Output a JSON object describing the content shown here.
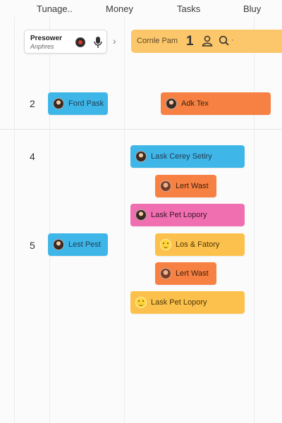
{
  "header": {
    "columns": [
      "Tunage..",
      "Money",
      "Tasks",
      "Bluy"
    ]
  },
  "search_card": {
    "title": "Presower",
    "subtitle": "Anphres"
  },
  "top_banner": {
    "label": "Cornle Pam",
    "count": "1"
  },
  "rows": {
    "row_2": "2",
    "row_4": "4",
    "row_5": "5"
  },
  "tasks": [
    {
      "label": "Ford Pask",
      "color": "#3fb6e8",
      "text_color": "#1d3a4f",
      "avatar": "avatar-dark"
    },
    {
      "label": "Adk Tex",
      "color": "#f78143",
      "text_color": "#3a1e0d",
      "avatar": "avatar-dark"
    },
    {
      "label": "Lask Cerey Setiry",
      "color": "#3fb6e8",
      "text_color": "#1d3a4f",
      "avatar": "avatar-dark"
    },
    {
      "label": "Lert Wast",
      "color": "#f78143",
      "text_color": "#3a1e0d",
      "avatar": "avatar-brown"
    },
    {
      "label": "Lask Pet Lopory",
      "color": "#f06fb1",
      "text_color": "#3b1428",
      "avatar": "avatar-dark"
    },
    {
      "label": "Lest Pest",
      "color": "#3fb6e8",
      "text_color": "#1d3a4f",
      "avatar": "avatar-dark"
    },
    {
      "label": "Los & Fatory",
      "color": "#fcc14c",
      "text_color": "#4a3505",
      "avatar": "avatar-emoji"
    },
    {
      "label": "Lert Wast",
      "color": "#f78143",
      "text_color": "#3a1e0d",
      "avatar": "avatar-brown"
    },
    {
      "label": "Lask Pet Lopory",
      "color": "#fcc14c",
      "text_color": "#4a3505",
      "avatar": "avatar-emoji"
    }
  ],
  "colors": {
    "banner": "#fcc66a",
    "blue": "#3fb6e8",
    "orange": "#f78143",
    "pink": "#f06fb1",
    "yellow": "#fcc14c"
  }
}
